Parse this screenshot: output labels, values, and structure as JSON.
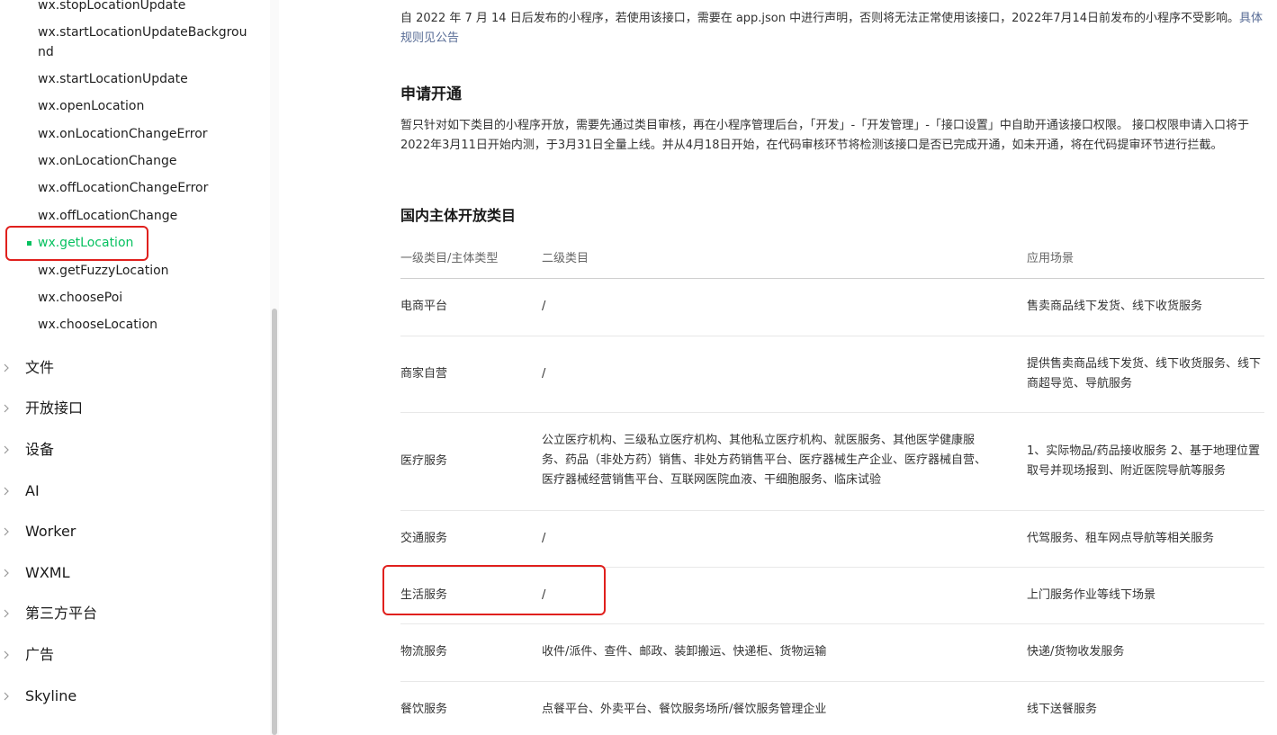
{
  "sidebar": {
    "api_items": [
      {
        "label": "wx.stopLocationUpdate"
      },
      {
        "label": "wx.startLocationUpdateBackground"
      },
      {
        "label": "wx.startLocationUpdate"
      },
      {
        "label": "wx.openLocation"
      },
      {
        "label": "wx.onLocationChangeError"
      },
      {
        "label": "wx.onLocationChange"
      },
      {
        "label": "wx.offLocationChangeError"
      },
      {
        "label": "wx.offLocationChange"
      },
      {
        "label": "wx.getLocation",
        "active": true
      },
      {
        "label": "wx.getFuzzyLocation"
      },
      {
        "label": "wx.choosePoi"
      },
      {
        "label": "wx.chooseLocation"
      }
    ],
    "categories": [
      {
        "label": "文件"
      },
      {
        "label": "开放接口"
      },
      {
        "label": "设备"
      },
      {
        "label": "AI"
      },
      {
        "label": "Worker"
      },
      {
        "label": "WXML"
      },
      {
        "label": "第三方平台"
      },
      {
        "label": "广告"
      },
      {
        "label": "Skyline"
      }
    ]
  },
  "content": {
    "intro_text": "自 2022 年 7 月 14 日后发布的小程序，若使用该接口，需要在 app.json 中进行声明，否则将无法正常使用该接口，2022年7月14日前发布的小程序不受影响。",
    "intro_link": "具体规则见公告",
    "apply_heading": "申请开通",
    "apply_text": "暂只针对如下类目的小程序开放，需要先通过类目审核，再在小程序管理后台，「开发」-「开发管理」-「接口设置」中自助开通该接口权限。 接口权限申请入口将于2022年3月11日开始内测，于3月31日全量上线。并从4月18日开始，在代码审核环节将检测该接口是否已完成开通，如未开通，将在代码提审环节进行拦截。",
    "table_heading": "国内主体开放类目",
    "table": {
      "headers": [
        "一级类目/主体类型",
        "二级类目",
        "应用场景"
      ],
      "rows": [
        {
          "c1": "电商平台",
          "c2": "/",
          "c3": "售卖商品线下发货、线下收货服务"
        },
        {
          "c1": "商家自营",
          "c2": "/",
          "c3": "提供售卖商品线下发货、线下收货服务、线下商超导览、导航服务"
        },
        {
          "c1": "医疗服务",
          "c2": "公立医疗机构、三级私立医疗机构、其他私立医疗机构、就医服务、其他医学健康服务、药品（非处方药）销售、非处方药销售平台、医疗器械生产企业、医疗器械自营、医疗器械经营销售平台、互联网医院血液、干细胞服务、临床试验",
          "c3": "1、实际物品/药品接收服务 2、基于地理位置取号并现场报到、附近医院导航等服务"
        },
        {
          "c1": "交通服务",
          "c2": "/",
          "c3": "代驾服务、租车网点导航等相关服务"
        },
        {
          "c1": "生活服务",
          "c2": "/",
          "c3": "上门服务作业等线下场景"
        },
        {
          "c1": "物流服务",
          "c2": "收件/派件、查件、邮政、装卸搬运、快递柜、货物运输",
          "c3": "快递/货物收发服务"
        },
        {
          "c1": "餐饮服务",
          "c2": "点餐平台、外卖平台、餐饮服务场所/餐饮服务管理企业",
          "c3": "线下送餐服务"
        }
      ]
    }
  },
  "colors": {
    "accent_green": "#07c160",
    "link_blue": "#576b95",
    "annotation_red": "#e0201d"
  },
  "icons": {
    "category_chevron": "chevron-right-icon"
  }
}
